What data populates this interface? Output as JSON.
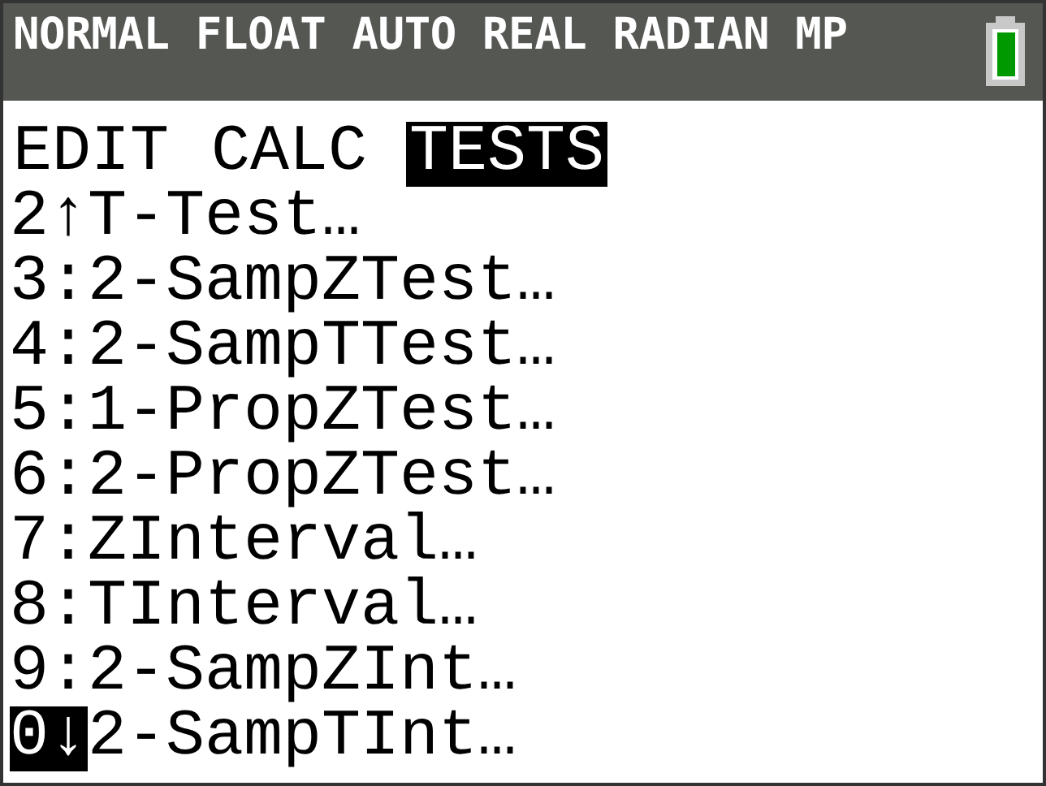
{
  "status_bar": {
    "modes": "NORMAL FLOAT AUTO REAL RADIAN MP"
  },
  "tabs": [
    {
      "label": "EDIT",
      "selected": false
    },
    {
      "label": "CALC",
      "selected": false
    },
    {
      "label": "TESTS",
      "selected": true
    }
  ],
  "menu": [
    {
      "key": "2↑",
      "label": "T-Test…",
      "selected": false
    },
    {
      "key": "3:",
      "label": "2-SampZTest…",
      "selected": false
    },
    {
      "key": "4:",
      "label": "2-SampTTest…",
      "selected": false
    },
    {
      "key": "5:",
      "label": "1-PropZTest…",
      "selected": false
    },
    {
      "key": "6:",
      "label": "2-PropZTest…",
      "selected": false
    },
    {
      "key": "7:",
      "label": "ZInterval…",
      "selected": false
    },
    {
      "key": "8:",
      "label": "TInterval…",
      "selected": false
    },
    {
      "key": "9:",
      "label": "2-SampZInt…",
      "selected": false
    },
    {
      "key": "0↓",
      "label": "2-SampTInt…",
      "selected": true
    }
  ]
}
